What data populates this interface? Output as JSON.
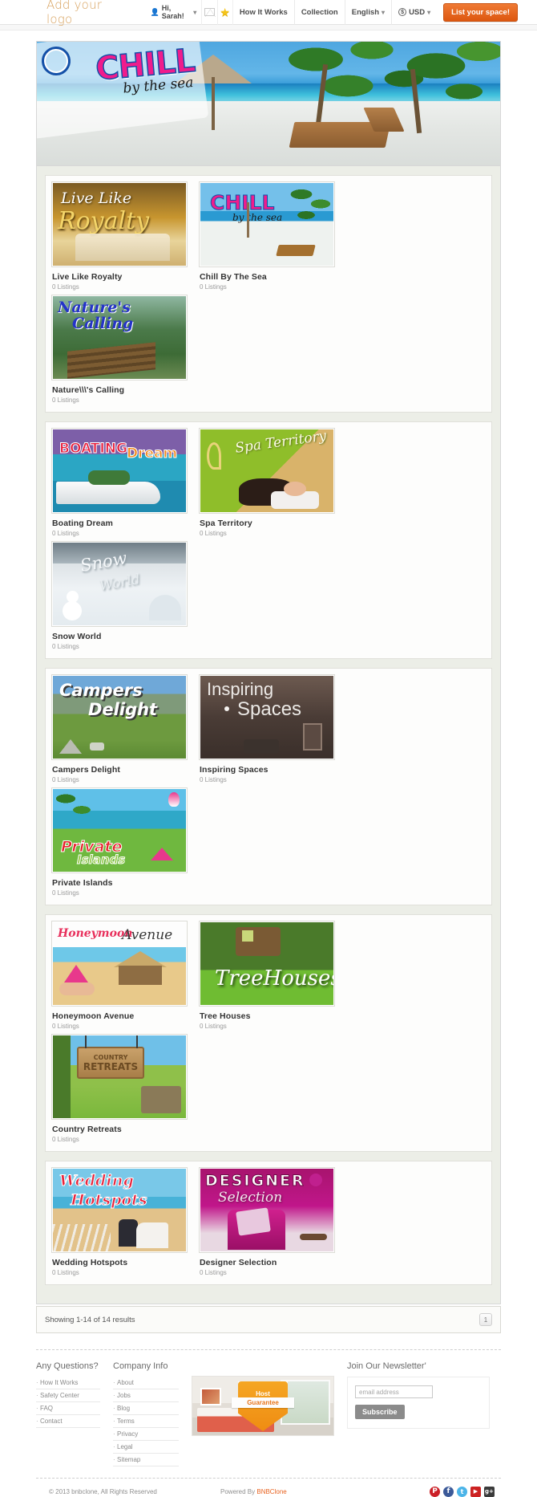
{
  "header": {
    "logo": "Add your logo",
    "user_greeting": "Hi, Sarah!",
    "user_icon": "user-icon",
    "caret": "▾",
    "messages_icon": "envelope-icon",
    "favorites_icon": "star-icon",
    "nav": [
      {
        "label": "How It Works",
        "caret": ""
      },
      {
        "label": "Collection",
        "caret": ""
      },
      {
        "label": "English",
        "caret": "▾"
      },
      {
        "label": "USD",
        "caret": "▾",
        "icon": "currency-icon",
        "icon_glyph": "$"
      }
    ],
    "cta_label": "List your space!"
  },
  "banner": {
    "title": "CHILL",
    "subtitle": "by the sea",
    "alt": "chill-by-the-sea-beach-banner"
  },
  "collections": [
    [
      {
        "title": "Live Like Royalty",
        "listings": "0 Listings",
        "image": "live-like-royalty-thumbnail"
      },
      {
        "title": "Chill By The Sea",
        "listings": "0 Listings",
        "image": "chill-by-the-sea-thumbnail"
      },
      {
        "title": "Nature\\\\\\'s Calling",
        "listings": "0 Listings",
        "image": "natures-calling-thumbnail"
      }
    ],
    [
      {
        "title": "Boating Dream",
        "listings": "0 Listings",
        "image": "boating-dream-thumbnail"
      },
      {
        "title": "Spa Territory",
        "listings": "0 Listings",
        "image": "spa-territory-thumbnail"
      },
      {
        "title": "Snow World",
        "listings": "0 Listings",
        "image": "snow-world-thumbnail"
      }
    ],
    [
      {
        "title": "Campers Delight",
        "listings": "0 Listings",
        "image": "campers-delight-thumbnail"
      },
      {
        "title": "Inspiring Spaces",
        "listings": "0 Listings",
        "image": "inspiring-spaces-thumbnail"
      },
      {
        "title": "Private Islands",
        "listings": "0 Listings",
        "image": "private-islands-thumbnail"
      }
    ],
    [
      {
        "title": "Honeymoon Avenue",
        "listings": "0 Listings",
        "image": "honeymoon-avenue-thumbnail"
      },
      {
        "title": "Tree Houses",
        "listings": "0 Listings",
        "image": "tree-houses-thumbnail"
      },
      {
        "title": "Country Retreats",
        "listings": "0 Listings",
        "image": "country-retreats-thumbnail"
      }
    ],
    [
      {
        "title": "Wedding Hotspots",
        "listings": "0 Listings",
        "image": "wedding-hotspots-thumbnail"
      },
      {
        "title": "Designer Selection",
        "listings": "0 Listings",
        "image": "designer-selection-thumbnail"
      }
    ]
  ],
  "results": {
    "showing_text": "Showing 1-14 of 14 results",
    "page_label": "1"
  },
  "footer": {
    "columns": [
      {
        "heading": "Any Questions?",
        "links": [
          "How It Works",
          "Safety Center",
          "FAQ",
          "Contact"
        ]
      },
      {
        "heading": "Company Info",
        "links": [
          "About",
          "Jobs",
          "Blog",
          "Terms",
          "Privacy",
          "Legal",
          "Sitemap"
        ]
      }
    ],
    "promo": {
      "badge_top": "Host",
      "badge_bottom": "Guarantee",
      "alt": "host-guarantee-bedroom"
    },
    "newsletter": {
      "heading": "Join Our Newsletter'",
      "placeholder": "email address",
      "value": "",
      "button": "Subscribe"
    }
  },
  "bottom": {
    "copyright": "© 2013 bnbclone, All Rights Reserved",
    "powered_prefix": "Powered By ",
    "powered_brand": "BNBClone",
    "socials": [
      {
        "name": "pinterest",
        "glyph": "P",
        "color": "#cb2027",
        "shape": "circle"
      },
      {
        "name": "facebook",
        "glyph": "f",
        "color": "#3b5998",
        "shape": "circle"
      },
      {
        "name": "twitter",
        "glyph": "t",
        "color": "#4bb4e8",
        "shape": "circle"
      },
      {
        "name": "youtube",
        "glyph": "▶",
        "color": "#d budget",
        "shape": "square"
      },
      {
        "name": "googleplus",
        "glyph": "g+",
        "color": "#3b3b3b",
        "shape": "square"
      }
    ]
  },
  "colors": {
    "accent": "#e8621f",
    "logo": "#d8a25e",
    "panel_bg": "#eceee7",
    "card_bg": "#fdfdfc"
  }
}
